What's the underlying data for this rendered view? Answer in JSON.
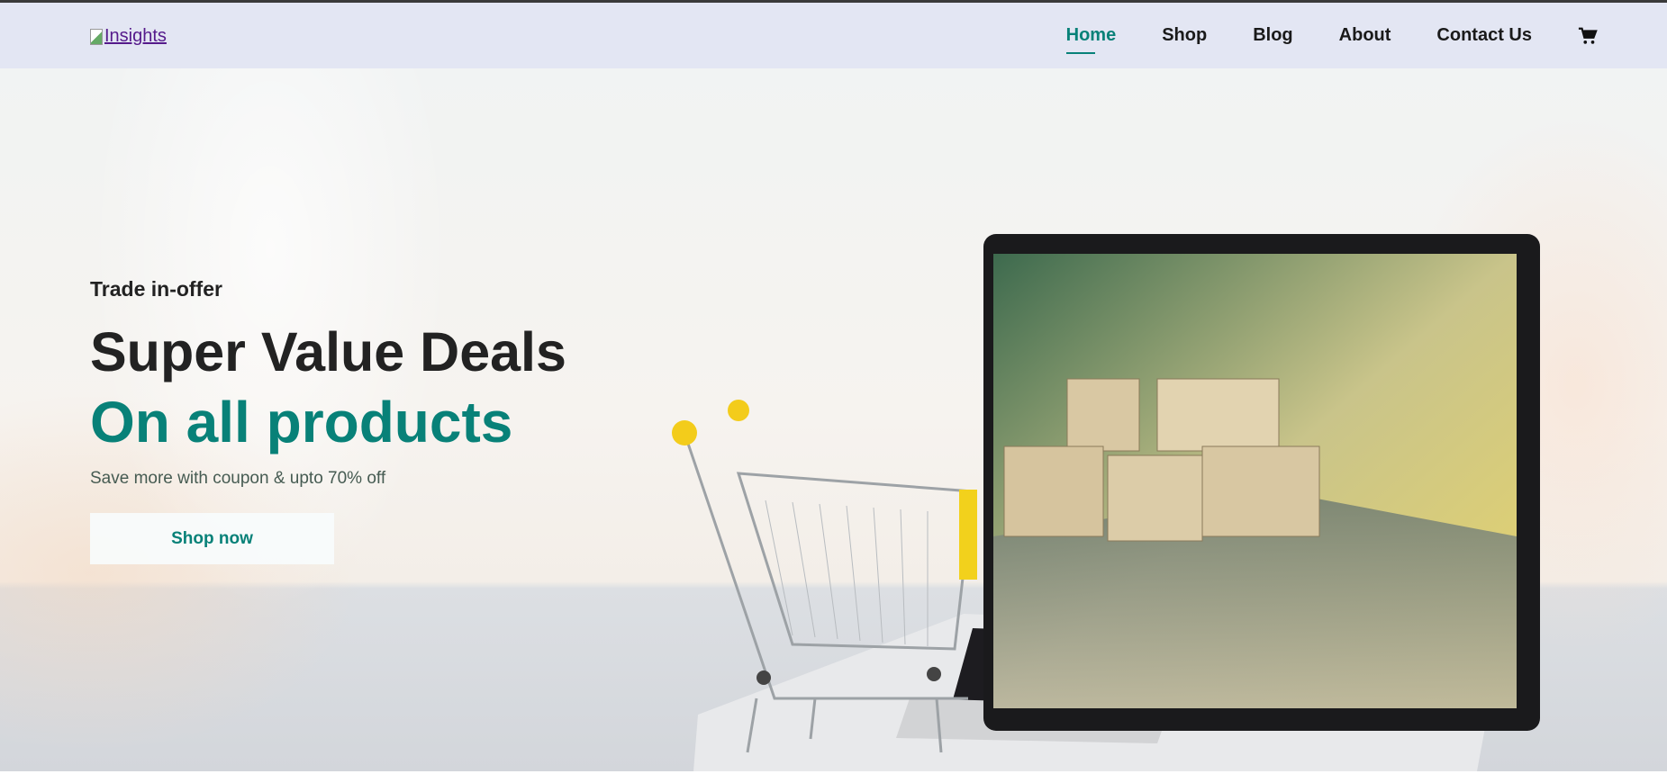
{
  "header": {
    "logo_alt": "Insights",
    "nav": [
      {
        "label": "Home",
        "active": true
      },
      {
        "label": "Shop"
      },
      {
        "label": "Blog"
      },
      {
        "label": "About"
      },
      {
        "label": "Contact Us"
      }
    ],
    "cart_icon": "shopping-cart-icon"
  },
  "hero": {
    "eyebrow": "Trade in-offer",
    "title": "Super Value Deals",
    "subtitle": "On all products",
    "description": "Save more with coupon & upto 70% off",
    "button": "Shop now"
  },
  "colors": {
    "accent": "#088178",
    "header_bg": "#e3e6f3"
  }
}
